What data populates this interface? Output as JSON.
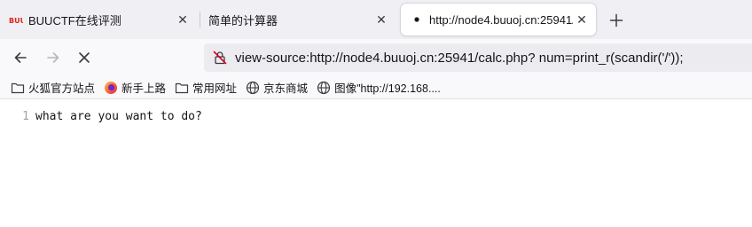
{
  "tabs": [
    {
      "title": "BUUCTF在线评测",
      "favicon": "buuctf-logo-icon",
      "active": false
    },
    {
      "title": "简单的计算器",
      "favicon": "",
      "active": false
    },
    {
      "title": "http://node4.buuoj.cn:25941/",
      "favicon": "loading-dot-icon",
      "active": true
    }
  ],
  "toolbar": {
    "url": "view-source:http://node4.buuoj.cn:25941/calc.php? num=print_r(scandir('/'));"
  },
  "bookmarks": [
    {
      "label": "火狐官方站点",
      "icon": "folder-icon"
    },
    {
      "label": "新手上路",
      "icon": "firefox-icon"
    },
    {
      "label": "常用网址",
      "icon": "folder-icon"
    },
    {
      "label": "京东商城",
      "icon": "globe-icon"
    },
    {
      "label": "图像\"http://192.168....",
      "icon": "globe-icon"
    }
  ],
  "source": {
    "lines": [
      {
        "number": "1",
        "text": "what are you want to do?"
      }
    ]
  },
  "colors": {
    "tabstrip_bg": "#f0f0f4",
    "toolbar_bg": "#f9f9fb",
    "urlbar_bg": "#ececf0",
    "buuctf_red": "#d9251d"
  }
}
